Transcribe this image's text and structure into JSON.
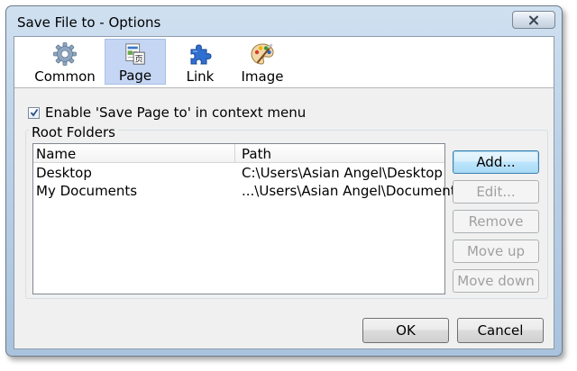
{
  "window": {
    "title": "Save File to - Options"
  },
  "tabs": [
    {
      "label": "Common",
      "icon": "gear-icon"
    },
    {
      "label": "Page",
      "icon": "page-icon",
      "selected": true
    },
    {
      "label": "Link",
      "icon": "puzzle-icon"
    },
    {
      "label": "Image",
      "icon": "palette-icon"
    }
  ],
  "options": {
    "enable_context_menu_label": "Enable 'Save Page to' in context menu",
    "enable_context_menu_checked": true
  },
  "root_folders": {
    "group_title": "Root Folders",
    "columns": [
      "Name",
      "Path"
    ],
    "rows": [
      {
        "name": "Desktop",
        "path": "C:\\Users\\Asian Angel\\Desktop"
      },
      {
        "name": "My Documents",
        "path": "...\\Users\\Asian Angel\\Documents"
      }
    ]
  },
  "side_buttons": {
    "add": "Add...",
    "edit": "Edit...",
    "remove": "Remove",
    "move_up": "Move up",
    "move_down": "Move down"
  },
  "footer": {
    "ok": "OK",
    "cancel": "Cancel"
  },
  "colors": {
    "selected_tab": "#c5d6f4",
    "default_button_border": "#3c7fb1",
    "title_bar": "#bcd2e8"
  }
}
